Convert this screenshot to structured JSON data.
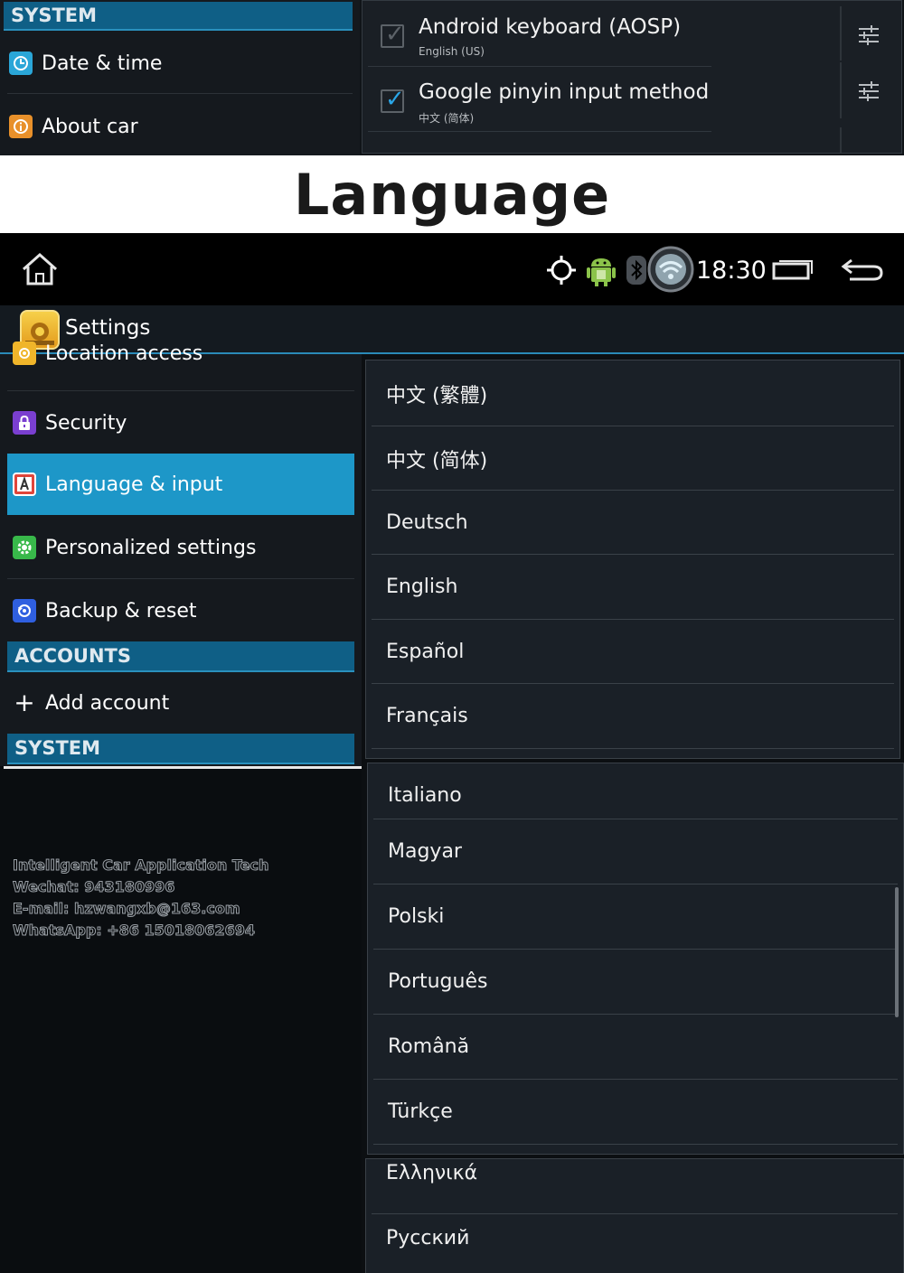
{
  "top_snippet": {
    "system_header": "SYSTEM",
    "items": [
      {
        "label": "Date & time",
        "icon": "clock-icon",
        "color": "#2aa6d8"
      },
      {
        "label": "About car",
        "icon": "info-icon",
        "color": "#e8902a"
      }
    ],
    "keyboards": [
      {
        "title": "Android keyboard (AOSP)",
        "subtitle": "English (US)",
        "checked": true
      },
      {
        "title": "Google pinyin input method",
        "subtitle": "中文 (简体)",
        "checked": true
      }
    ]
  },
  "banner": {
    "title": "Language"
  },
  "status_bar": {
    "time": "18:30"
  },
  "action_bar": {
    "title": "Settings"
  },
  "sidebar": {
    "items": [
      {
        "label": "Location access",
        "icon": "location-icon",
        "color": "#f0b52a"
      },
      {
        "label": "Security",
        "icon": "lock-icon",
        "color": "#7a3fd0"
      },
      {
        "label": "Language & input",
        "icon": "language-icon",
        "color": "#e0453a",
        "active": true
      },
      {
        "label": "Personalized settings",
        "icon": "gear-icon",
        "color": "#38b84a"
      },
      {
        "label": "Backup & reset",
        "icon": "backup-icon",
        "color": "#2f5fe0"
      }
    ],
    "accounts_header": "ACCOUNTS",
    "add_account": "Add account",
    "system_header": "SYSTEM"
  },
  "watermark": {
    "lines": [
      "Intelligent Car Application Tech",
      "Wechat: 943180996",
      "E-mail: hzwangxb@163.com",
      "WhatsApp: +86 15018062694"
    ]
  },
  "languages": {
    "group1": [
      "中文 (繁體)",
      "中文 (简体)",
      "Deutsch",
      "English",
      "Español",
      "Français"
    ],
    "group2": [
      "Italiano",
      "Magyar",
      "Polski",
      "Português",
      "Română",
      "Türkçe"
    ],
    "group3": [
      "Ελληνικά",
      "Русский"
    ]
  },
  "colors": {
    "accent": "#1d97c8",
    "header": "#0f5f86",
    "check": "#2aa6e8"
  }
}
